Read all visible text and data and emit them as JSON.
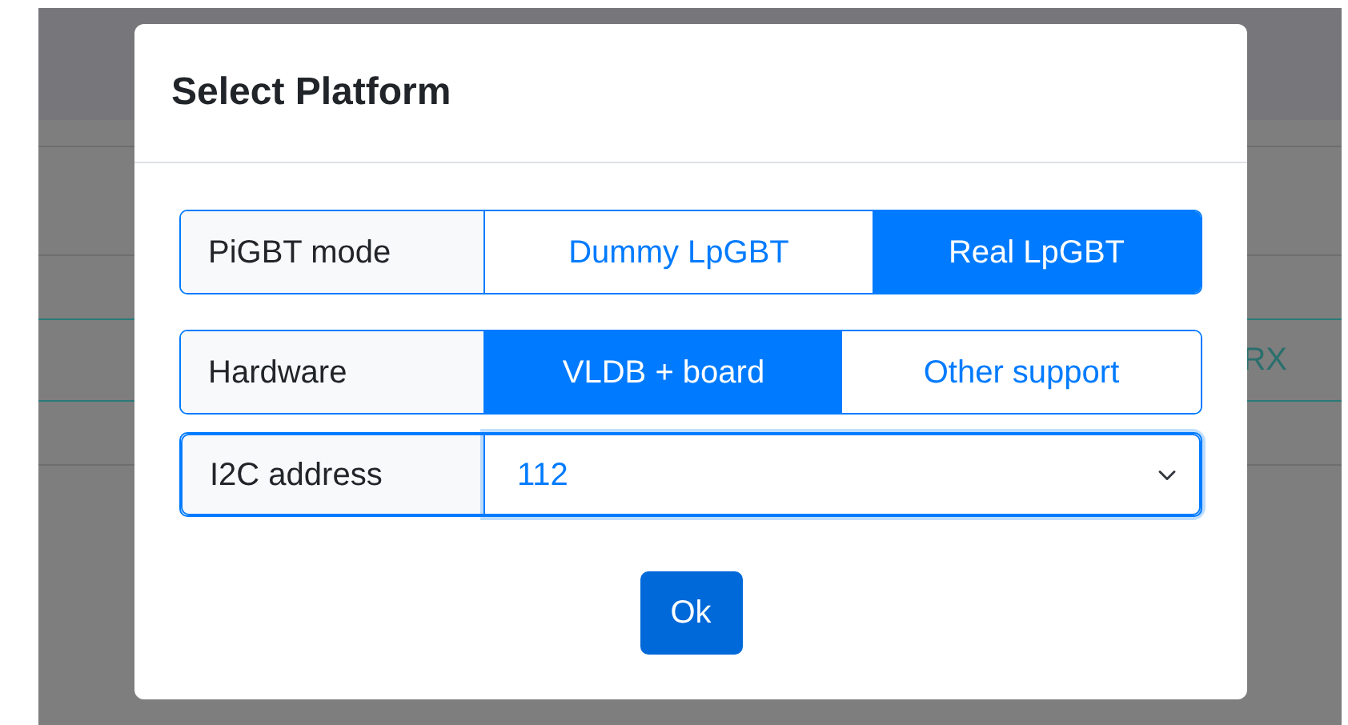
{
  "background": {
    "row_text": "RX"
  },
  "dialog": {
    "title": "Select Platform",
    "groups": [
      {
        "kind": "toggle",
        "label": "PiGBT mode",
        "options": [
          {
            "label": "Dummy LpGBT",
            "selected": false
          },
          {
            "label": "Real LpGBT",
            "selected": true
          }
        ]
      },
      {
        "kind": "toggle",
        "label": "Hardware",
        "options": [
          {
            "label": "VLDB + board",
            "selected": true
          },
          {
            "label": "Other support",
            "selected": false
          }
        ]
      },
      {
        "kind": "select",
        "label": "I2C address",
        "value": "112"
      }
    ],
    "button": "Ok"
  }
}
